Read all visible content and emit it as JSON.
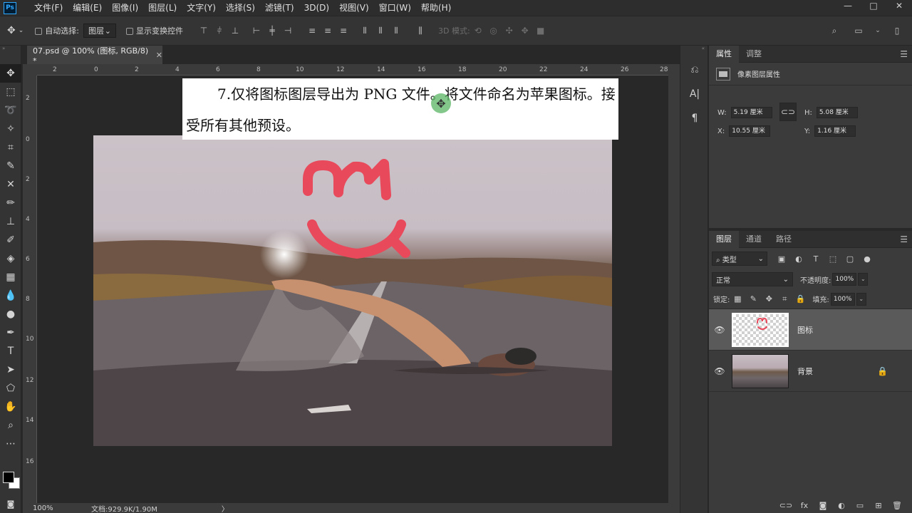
{
  "app": {
    "logo": "Ps"
  },
  "menu": [
    "文件(F)",
    "编辑(E)",
    "图像(I)",
    "图层(L)",
    "文字(Y)",
    "选择(S)",
    "滤镜(T)",
    "3D(D)",
    "视图(V)",
    "窗口(W)",
    "帮助(H)"
  ],
  "window_controls": {
    "minimize": "—",
    "maximize": "□",
    "close": "✕"
  },
  "options": {
    "auto_select_label": "自动选择:",
    "auto_select_value": "图层",
    "show_transform_label": "显示变换控件",
    "mode_3d_label": "3D 模式:"
  },
  "document": {
    "tab_title": "07.psd @ 100% (图标, RGB/8) *",
    "tab_close": "✕",
    "ruler_h": [
      "2",
      "0",
      "2",
      "4",
      "6",
      "8",
      "10",
      "12",
      "14",
      "16",
      "18",
      "20",
      "22",
      "24",
      "26",
      "28"
    ],
    "ruler_v": [
      "2",
      "0",
      "2",
      "4",
      "6",
      "8",
      "10",
      "12",
      "14",
      "16"
    ],
    "instruction_text": "7.仅将图标图层导出为 PNG 文件。将文件命名为苹果图标。接受所有其他预设。",
    "status_zoom": "100%",
    "status_doc": "文档:929.9K/1.90M",
    "status_arrow": "〉",
    "brand_color": "#e8495b"
  },
  "properties_panel": {
    "tabs": [
      "属性",
      "调整"
    ],
    "header_label": "像素图层属性",
    "w_label": "W:",
    "w_value": "5.19 厘米",
    "h_label": "H:",
    "h_value": "5.08 厘米",
    "x_label": "X:",
    "x_value": "10.55 厘米",
    "y_label": "Y:",
    "y_value": "1.16 厘米"
  },
  "layers_panel": {
    "tabs": [
      "图层",
      "通道",
      "路径"
    ],
    "filter_value": "类型",
    "blend_mode": "正常",
    "opacity_label": "不透明度:",
    "opacity_value": "100%",
    "lock_label": "锁定:",
    "fill_label": "填充:",
    "fill_value": "100%",
    "layers": [
      {
        "name": "图标",
        "selected": true
      },
      {
        "name": "背景",
        "selected": false,
        "locked": true
      }
    ]
  }
}
